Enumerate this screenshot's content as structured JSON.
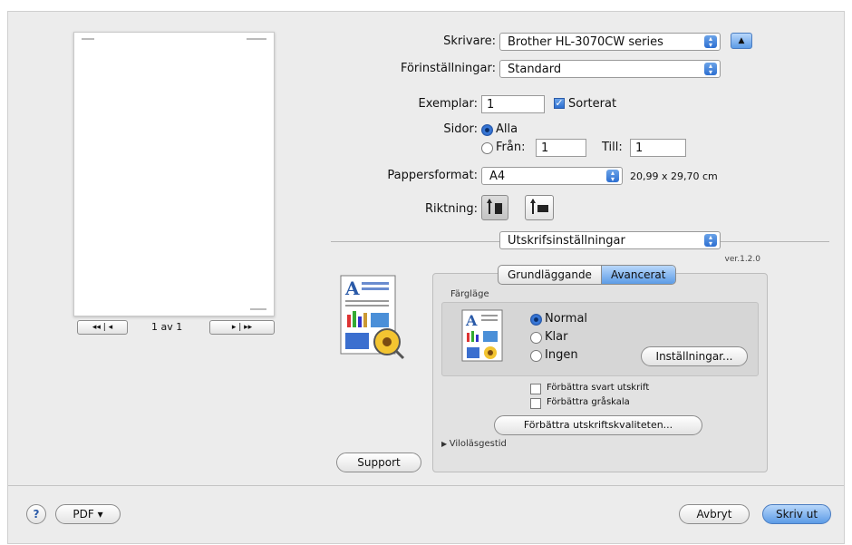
{
  "printer": {
    "label": "Skrivare:",
    "value": "Brother HL-3070CW series"
  },
  "presets": {
    "label": "Förinställningar:",
    "value": "Standard"
  },
  "copies": {
    "label": "Exemplar:",
    "value": "1",
    "collated_label": "Sorterat",
    "collated": true
  },
  "pages": {
    "label": "Sidor:",
    "all_label": "Alla",
    "from_label": "Från:",
    "from_value": "1",
    "to_label": "Till:",
    "to_value": "1",
    "selected": "all"
  },
  "paper": {
    "label": "Pappersformat:",
    "value": "A4",
    "size": "20,99 x 29,70 cm"
  },
  "orientation": {
    "label": "Riktning:",
    "selected": "portrait"
  },
  "section": {
    "value": "Utskrifsinställningar",
    "version": "ver.1.2.0"
  },
  "tabs": [
    {
      "label": "Grundläggande"
    },
    {
      "label": "Avancerat"
    }
  ],
  "active_tab": "Avancerat",
  "color_mode": {
    "title": "Färgläge",
    "options": [
      "Normal",
      "Klar",
      "Ingen"
    ],
    "selected": "Normal",
    "settings_button": "Inställningar..."
  },
  "options": [
    {
      "label": "Förbättra svart utskrift",
      "checked": false
    },
    {
      "label": "Förbättra gråskala",
      "checked": false
    }
  ],
  "improve_button": "Förbättra utskriftskvaliteten...",
  "sleep": {
    "label": "Viloläsgestid"
  },
  "support_button": "Support",
  "preview": {
    "page_text": "1 av 1"
  },
  "footer": {
    "help": "?",
    "pdf": "PDF ▾",
    "cancel": "Avbryt",
    "print": "Skriv ut"
  },
  "colors": {
    "accent": "#3d7fe0",
    "background": "#ececec"
  }
}
